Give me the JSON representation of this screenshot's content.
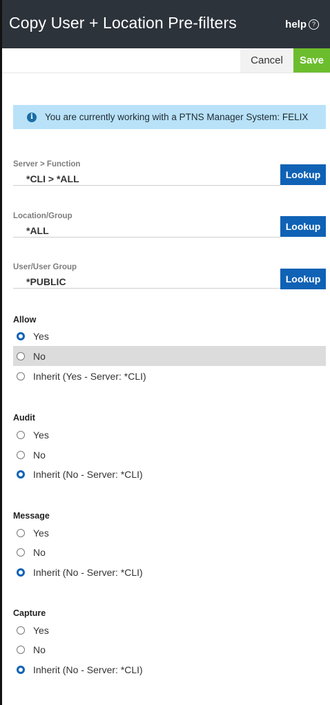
{
  "header": {
    "title": "Copy User + Location Pre-filters",
    "help_label": "help",
    "help_icon": "?"
  },
  "toolbar": {
    "cancel_label": "Cancel",
    "save_label": "Save"
  },
  "info": {
    "icon": "i",
    "message": "You are currently working with a PTNS Manager System: FELIX"
  },
  "fields": [
    {
      "label": "Server > Function",
      "value": "*CLI > *ALL",
      "button": "Lookup"
    },
    {
      "label": "Location/Group",
      "value": "*ALL",
      "button": "Lookup"
    },
    {
      "label": "User/User Group",
      "value": "*PUBLIC",
      "button": "Lookup"
    }
  ],
  "groups": [
    {
      "label": "Allow",
      "options": [
        "Yes",
        "No",
        "Inherit (Yes - Server: *CLI)"
      ],
      "selected": 0,
      "highlighted": 1
    },
    {
      "label": "Audit",
      "options": [
        "Yes",
        "No",
        "Inherit (No - Server: *CLI)"
      ],
      "selected": 2
    },
    {
      "label": "Message",
      "options": [
        "Yes",
        "No",
        "Inherit (No - Server: *CLI)"
      ],
      "selected": 2
    },
    {
      "label": "Capture",
      "options": [
        "Yes",
        "No",
        "Inherit (No - Server: *CLI)"
      ],
      "selected": 2
    }
  ],
  "colors": {
    "header_bg": "#2d333b",
    "save_green": "#6cbd2d",
    "lookup_blue": "#0f62b5",
    "info_bg": "#b9e2f8"
  }
}
